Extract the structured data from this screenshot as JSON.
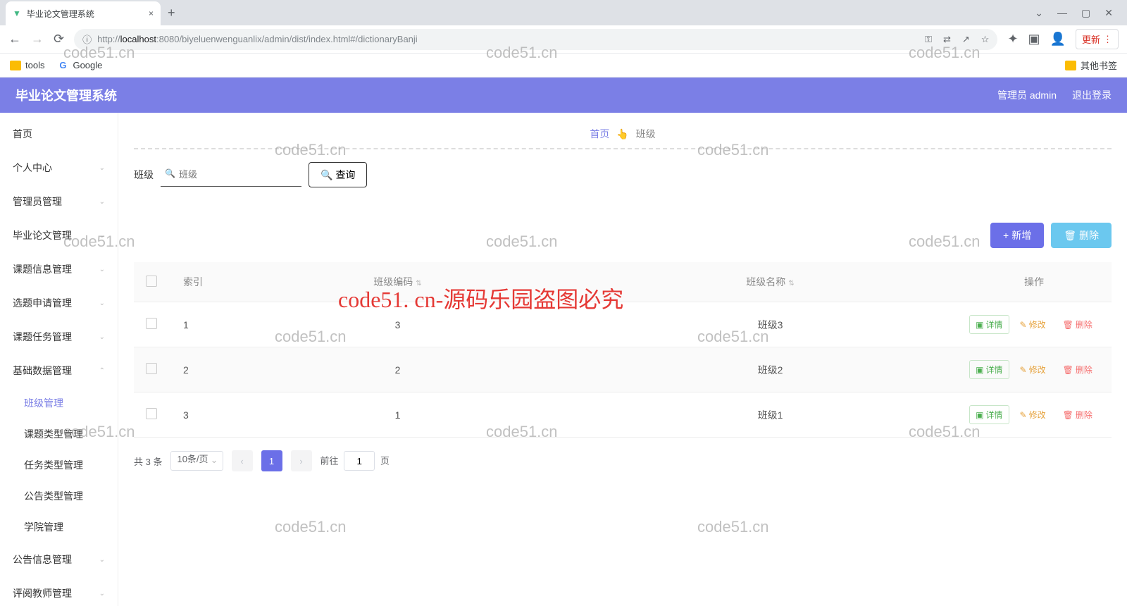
{
  "browser": {
    "tab_title": "毕业论文管理系统",
    "url_host": "localhost",
    "url_prefix": "http://",
    "url_port_path": ":8080/biyeluenwenguanlix/admin/dist/index.html#/dictionaryBanji",
    "update_label": "更新",
    "bookmarks": {
      "tools": "tools",
      "google": "Google",
      "other": "其他书签"
    }
  },
  "header": {
    "system_title": "毕业论文管理系统",
    "user_label": "管理员 admin",
    "logout_label": "退出登录"
  },
  "sidebar": {
    "items": [
      {
        "label": "首页"
      },
      {
        "label": "个人中心"
      },
      {
        "label": "管理员管理"
      },
      {
        "label": "毕业论文管理"
      },
      {
        "label": "课题信息管理"
      },
      {
        "label": "选题申请管理"
      },
      {
        "label": "课题任务管理"
      },
      {
        "label": "基础数据管理"
      },
      {
        "label": "公告信息管理"
      },
      {
        "label": "评阅教师管理"
      }
    ],
    "subs": [
      {
        "label": "班级管理"
      },
      {
        "label": "课题类型管理"
      },
      {
        "label": "任务类型管理"
      },
      {
        "label": "公告类型管理"
      },
      {
        "label": "学院管理"
      }
    ]
  },
  "breadcrumb": {
    "home": "首页",
    "sep": "👆",
    "current": "班级"
  },
  "search": {
    "label": "班级",
    "placeholder": "班级",
    "query_btn": "查询"
  },
  "actions": {
    "add": "新增",
    "delete": "删除"
  },
  "table": {
    "headers": {
      "index": "索引",
      "code": "班级编码",
      "name": "班级名称",
      "ops": "操作"
    },
    "ops": {
      "detail": "详情",
      "edit": "修改",
      "delete": "删除"
    },
    "rows": [
      {
        "idx": "1",
        "code": "3",
        "name": "班级3"
      },
      {
        "idx": "2",
        "code": "2",
        "name": "班级2"
      },
      {
        "idx": "3",
        "code": "1",
        "name": "班级1"
      }
    ]
  },
  "pagination": {
    "total_label": "共 3 条",
    "page_size": "10条/页",
    "current_page": "1",
    "goto_prefix": "前往",
    "goto_value": "1",
    "goto_suffix": "页"
  },
  "watermarks": {
    "grey": "code51.cn",
    "red": "code51. cn-源码乐园盗图必究"
  }
}
